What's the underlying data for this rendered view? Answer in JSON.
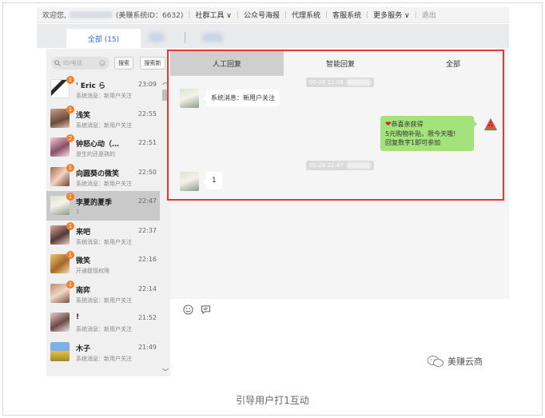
{
  "topbar": {
    "greeting": "欢迎您,",
    "account_id": "(美赚系统ID：6632)",
    "menu": [
      "社群工具 ∨",
      "公众号海报",
      "代理系统",
      "客服系统",
      "更多服务 ∨"
    ],
    "logout": "退出"
  },
  "tabs": {
    "all_label": "全部 (15)"
  },
  "search": {
    "placeholder": "ID/电话",
    "search_label": "搜索",
    "search_new_label": "搜索新"
  },
  "conversations": [
    {
      "name": "' Eric ら",
      "preview": "系统消息：新用户关注",
      "time": "23:09",
      "badge": "1"
    },
    {
      "name": "浅笑",
      "preview": "系统消息：新用户关注",
      "time": "22:55",
      "badge": "1"
    },
    {
      "name": "钟怒心动（…",
      "preview": "是生的还是熟的",
      "time": "22:51",
      "badge": "2"
    },
    {
      "name": "向圆葵の微笑",
      "preview": "系统消息：新用户关注",
      "time": "22:50",
      "badge": "1"
    },
    {
      "name": "李夏的夏季",
      "preview": "1",
      "time": "22:47",
      "badge": "1",
      "selected": true
    },
    {
      "name": "来吧",
      "preview": "系统消息：新用户关注",
      "time": "22:37",
      "badge": "1"
    },
    {
      "name": "微笑",
      "preview": "开通提现权限",
      "time": "22:16",
      "badge": "1"
    },
    {
      "name": "南弈",
      "preview": "系统消息：新用户关注",
      "time": "22:14",
      "badge": "1"
    },
    {
      "name": "!",
      "preview": "系统消息：新用户关注",
      "time": "21:52",
      "badge": ""
    },
    {
      "name": "木子",
      "preview": "系统消息：新用户关注",
      "time": "21:49",
      "badge": ""
    }
  ],
  "chat_tabs": [
    "人工回复",
    "智能回复",
    "全部"
  ],
  "messages": {
    "time1": "05-28 11:09",
    "time2": "05-28 22:47",
    "sys_msg": "系统消息：新用户关注",
    "promo_line1": "恭喜亲获得",
    "promo_line2": "5元购物补贴，限今天哦!",
    "promo_line3": "回复数字1即可参加",
    "user_reply": "1"
  },
  "watermark": "美赚云商",
  "caption": "引导用户打1互动",
  "colors": {
    "accent": "#2c6fd1",
    "badge": "#f2802a",
    "bubble_green": "#a4e27c",
    "highlight_border": "#e53935"
  }
}
